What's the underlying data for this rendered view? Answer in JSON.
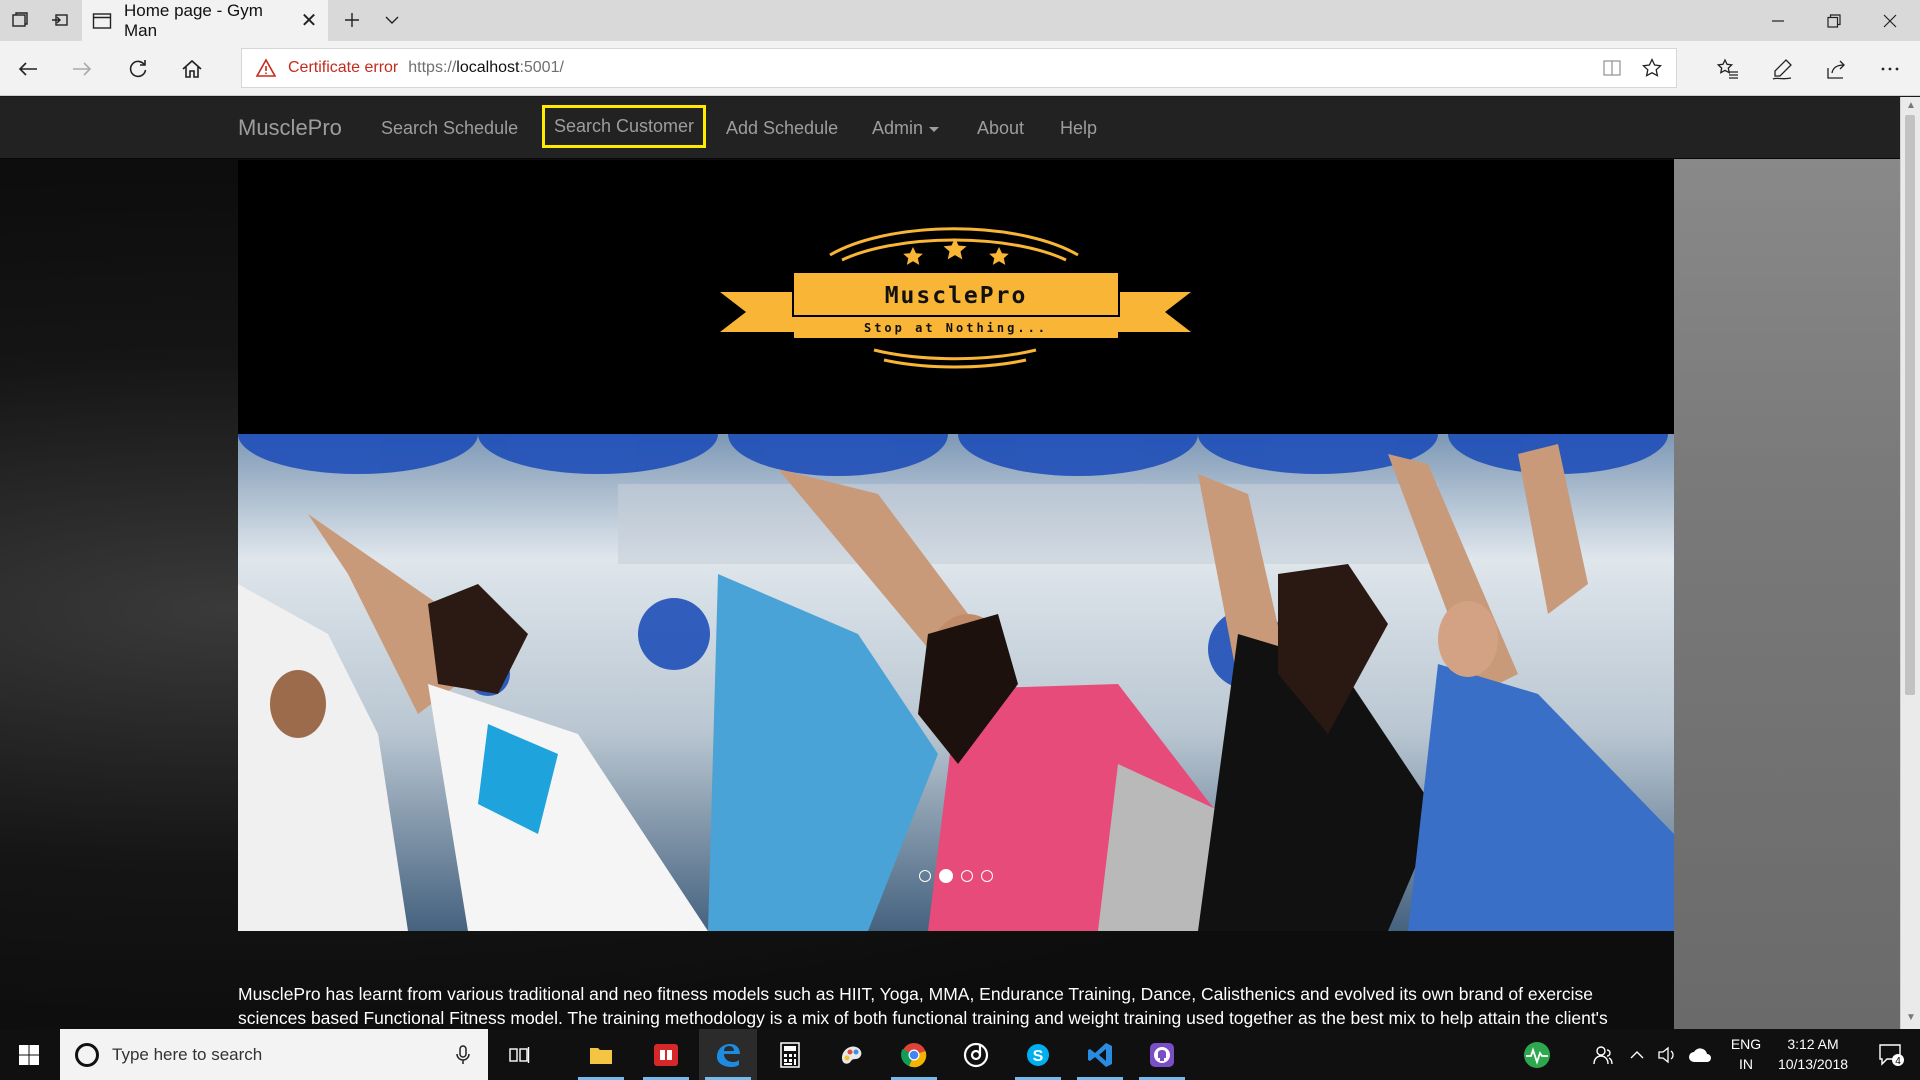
{
  "browser": {
    "tab_title": "Home page - Gym Man",
    "cert_error": "Certificate error",
    "url_scheme": "https://",
    "url_host": "localhost",
    "url_rest": ":5001/"
  },
  "site": {
    "brand": "MusclePro",
    "nav": {
      "search_schedule": "Search Schedule",
      "search_customer": "Search Customer",
      "add_schedule": "Add Schedule",
      "admin": "Admin",
      "about": "About",
      "help": "Help"
    },
    "highlight_color": "#ffeb00",
    "logo": {
      "name": "MusclePro",
      "tagline": "Stop at Nothing...",
      "color": "#f9b536"
    },
    "carousel": {
      "slides": 4,
      "active_index": 1
    },
    "intro_line1": "MusclePro has learnt from various traditional and neo fitness models such as HIIT, Yoga, MMA, Endurance Training, Dance, Calisthenics and evolved its own brand of exercise",
    "intro_line2": "sciences based Functional Fitness model. The training methodology is a mix of both functional training and weight training used together as the best mix to help attain the client's"
  },
  "taskbar": {
    "search_placeholder": "Type here to search",
    "lang_line1": "ENG",
    "lang_line2": "IN",
    "time": "3:12 AM",
    "date": "10/13/2018",
    "notification_count": "4"
  }
}
